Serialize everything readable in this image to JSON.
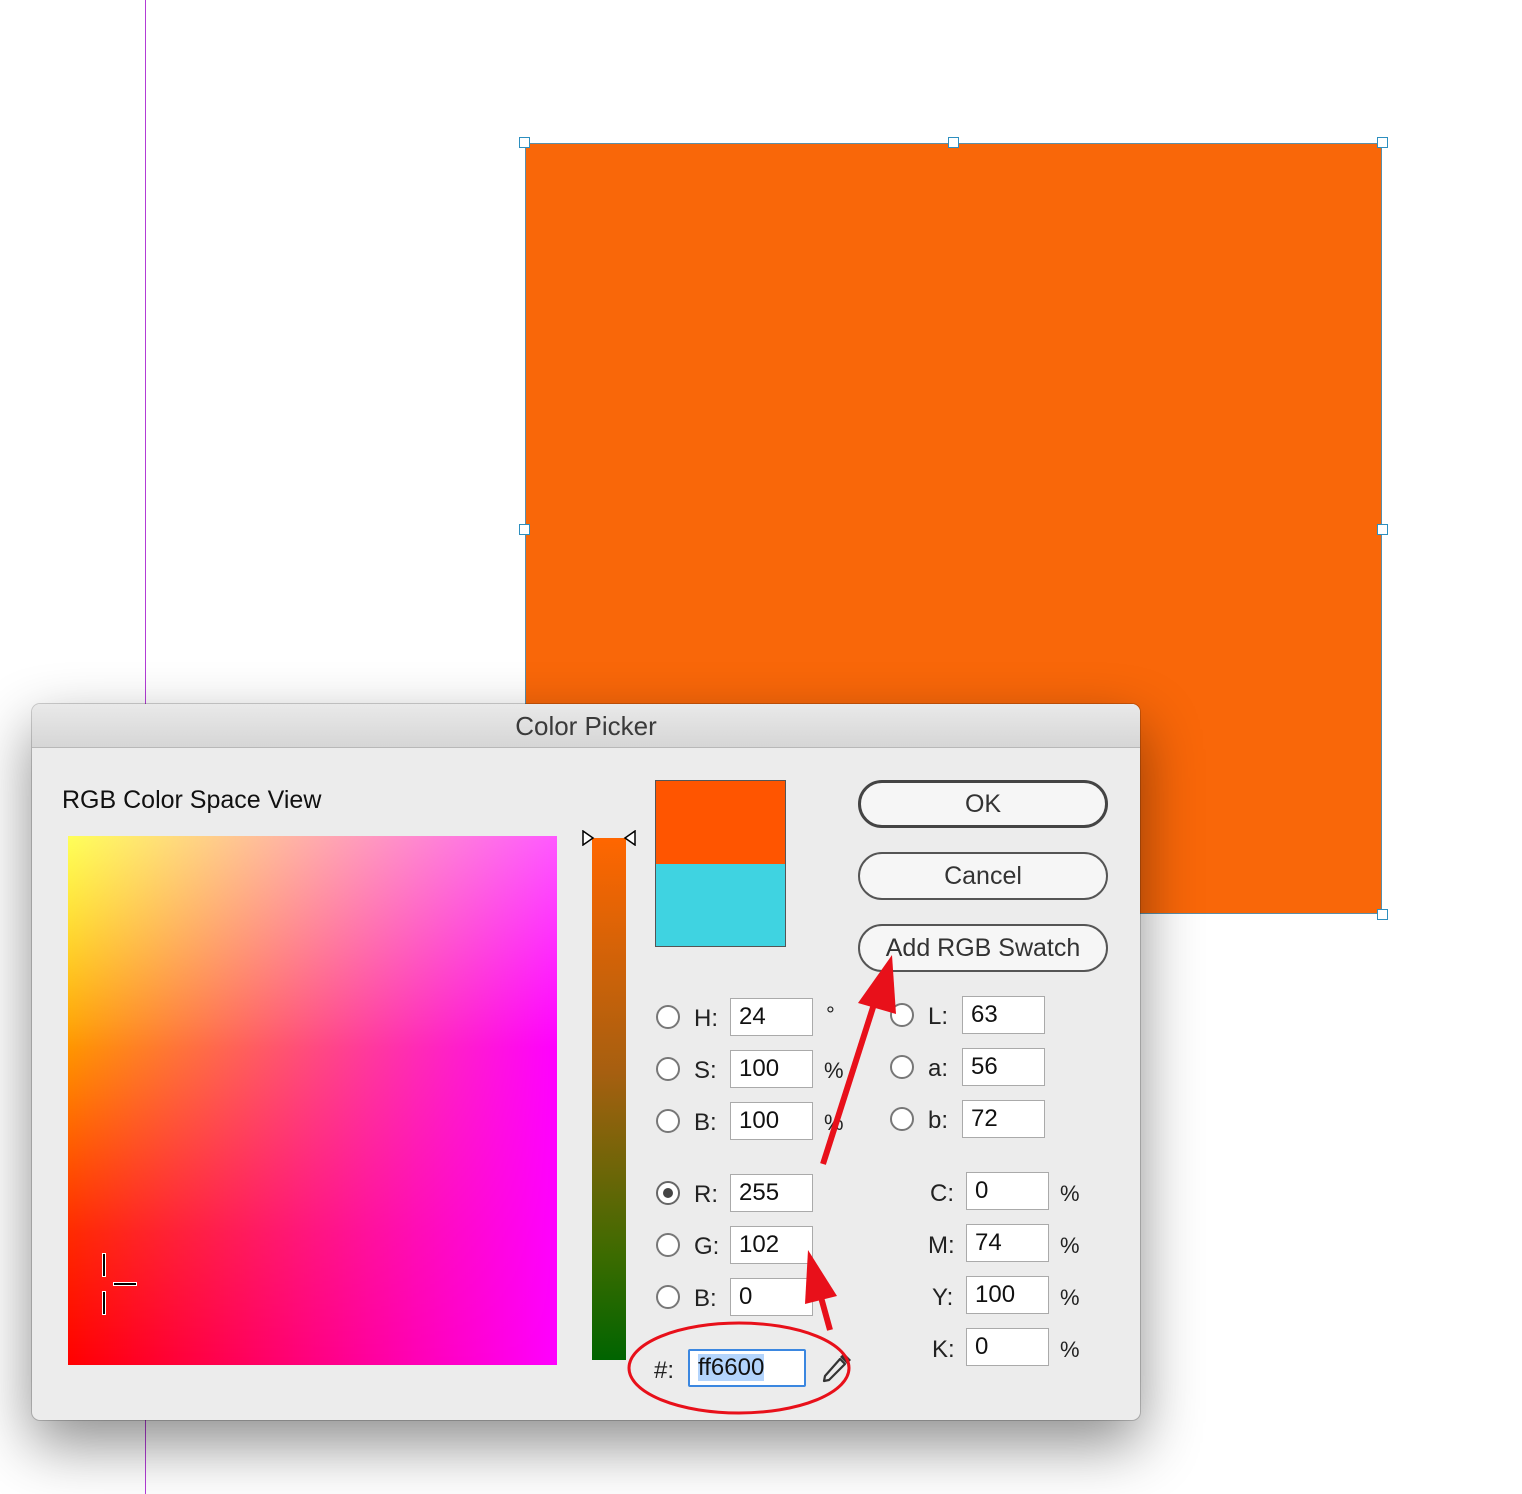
{
  "dialog": {
    "title": "Color Picker",
    "color_space_label": "RGB Color Space View",
    "new_color": "#ff5500",
    "original_color": "#3fd3e1",
    "canvas_fill_color": "#f96709"
  },
  "buttons": {
    "ok": "OK",
    "cancel": "Cancel",
    "add_swatch": "Add RGB Swatch"
  },
  "hsb": {
    "h": {
      "label": "H:",
      "value": "24",
      "unit": "°"
    },
    "s": {
      "label": "S:",
      "value": "100",
      "unit": "%"
    },
    "b": {
      "label": "B:",
      "value": "100",
      "unit": "%"
    }
  },
  "rgb": {
    "r": {
      "label": "R:",
      "value": "255"
    },
    "g": {
      "label": "G:",
      "value": "102"
    },
    "b": {
      "label": "B:",
      "value": "0"
    },
    "selected": "R"
  },
  "lab": {
    "l": {
      "label": "L:",
      "value": "63"
    },
    "a": {
      "label": "a:",
      "value": "56"
    },
    "b": {
      "label": "b:",
      "value": "72"
    }
  },
  "cmyk": {
    "c": {
      "label": "C:",
      "value": "0",
      "unit": "%"
    },
    "m": {
      "label": "M:",
      "value": "74",
      "unit": "%"
    },
    "y": {
      "label": "Y:",
      "value": "100",
      "unit": "%"
    },
    "k": {
      "label": "K:",
      "value": "0",
      "unit": "%"
    }
  },
  "hex": {
    "label": "#:",
    "value": "ff6600"
  },
  "icons": {
    "eyedropper": "eyedropper-icon"
  },
  "annotation_color": "#e8101a"
}
